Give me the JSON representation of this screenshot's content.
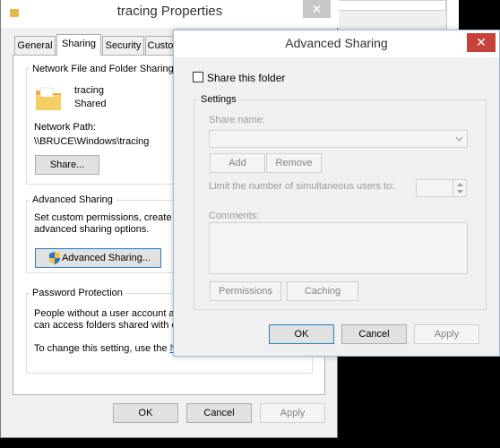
{
  "props_window": {
    "title": "tracing Properties",
    "close_glyph": "✕",
    "tabs": [
      "General",
      "Sharing",
      "Security",
      "Custo"
    ],
    "network_group": {
      "label": "Network File and Folder Sharing",
      "folder_name": "tracing",
      "folder_status": "Shared",
      "network_path_label": "Network Path:",
      "network_path": "\\\\BRUCE\\Windows\\tracing",
      "share_button": "Share..."
    },
    "advanced_group": {
      "label": "Advanced Sharing",
      "desc_line1": "Set custom permissions, create m",
      "desc_line2": "advanced sharing options.",
      "button": "Advanced Sharing..."
    },
    "password_group": {
      "label": "Password Protection",
      "line1": "People without a user account ar",
      "line2": "can access folders shared with e",
      "line3_prefix": "To change this setting, use the ",
      "line3_link": "N"
    },
    "buttons": {
      "ok": "OK",
      "cancel": "Cancel",
      "apply": "Apply"
    }
  },
  "advanced_dialog": {
    "title": "Advanced Sharing",
    "close_glyph": "✕",
    "share_checkbox_label": "Share this folder",
    "share_checked": false,
    "settings_label": "Settings",
    "share_name_label": "Share name:",
    "add_button": "Add",
    "remove_button": "Remove",
    "limit_label": "Limit the number of simultaneous users to:",
    "comments_label": "Comments:",
    "permissions_button": "Permissions",
    "caching_button": "Caching",
    "buttons": {
      "ok": "OK",
      "cancel": "Cancel",
      "apply": "Apply"
    }
  },
  "icons": {
    "folder": "folder-icon",
    "shield": "uac-shield-icon",
    "dropdown": "chevron-down-icon",
    "spin_up": "spin-up-icon",
    "spin_down": "spin-down-icon"
  },
  "colors": {
    "accent_border": "#3c7fb1",
    "close_active": "#c7423a",
    "link": "#0066cc"
  }
}
